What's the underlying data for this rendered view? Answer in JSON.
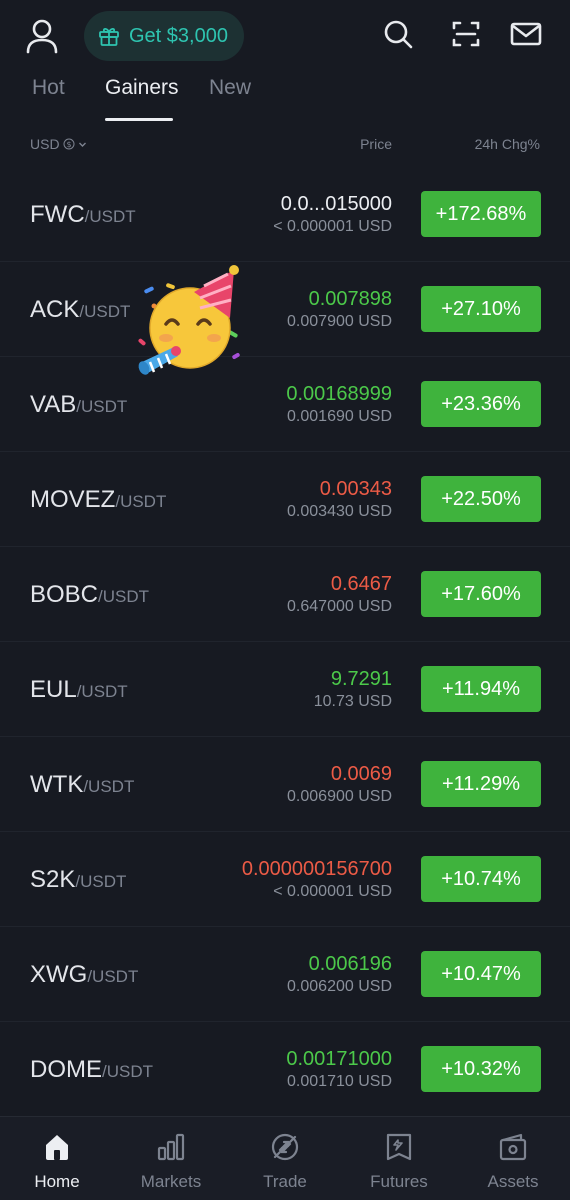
{
  "header": {
    "promo_label": "Get $3,000",
    "icons": [
      "profile-icon",
      "gift-icon",
      "search-icon",
      "scan-icon",
      "mail-icon"
    ]
  },
  "tabs": [
    {
      "label": "Hot",
      "active": false
    },
    {
      "label": "Gainers",
      "active": true
    },
    {
      "label": "New",
      "active": false
    }
  ],
  "columns": {
    "currency": "USD",
    "price": "Price",
    "change": "24h Chg%"
  },
  "colors": {
    "background": "#171a22",
    "accent_teal": "#2ec4b0",
    "up_green": "#4cc94a",
    "down_red": "#ec5b46",
    "change_badge": "#3fb33d"
  },
  "rows": [
    {
      "base": "FWC",
      "quote": "/USDT",
      "price": "0.0...015000",
      "price_color": "white",
      "usd": "< 0.000001 USD",
      "change": "+172.68%"
    },
    {
      "base": "ACK",
      "quote": "/USDT",
      "price": "0.007898",
      "price_color": "green",
      "usd": "0.007900 USD",
      "change": "+27.10%"
    },
    {
      "base": "VAB",
      "quote": "/USDT",
      "price": "0.00168999",
      "price_color": "green",
      "usd": "0.001690 USD",
      "change": "+23.36%"
    },
    {
      "base": "MOVEZ",
      "quote": "/USDT",
      "price": "0.00343",
      "price_color": "red",
      "usd": "0.003430 USD",
      "change": "+22.50%"
    },
    {
      "base": "BOBC",
      "quote": "/USDT",
      "price": "0.6467",
      "price_color": "red",
      "usd": "0.647000 USD",
      "change": "+17.60%"
    },
    {
      "base": "EUL",
      "quote": "/USDT",
      "price": "9.7291",
      "price_color": "green",
      "usd": "10.73 USD",
      "change": "+11.94%"
    },
    {
      "base": "WTK",
      "quote": "/USDT",
      "price": "0.0069",
      "price_color": "red",
      "usd": "0.006900 USD",
      "change": "+11.29%"
    },
    {
      "base": "S2K",
      "quote": "/USDT",
      "price": "0.000000156700",
      "price_color": "red",
      "usd": "< 0.000001 USD",
      "change": "+10.74%"
    },
    {
      "base": "XWG",
      "quote": "/USDT",
      "price": "0.006196",
      "price_color": "green",
      "usd": "0.006200 USD",
      "change": "+10.47%"
    },
    {
      "base": "DOME",
      "quote": "/USDT",
      "price": "0.00171000",
      "price_color": "green",
      "usd": "0.001710 USD",
      "change": "+10.32%"
    }
  ],
  "sticker": "partying-face-emoji",
  "bottom_nav": [
    {
      "label": "Home",
      "icon": "home-icon",
      "active": true
    },
    {
      "label": "Markets",
      "icon": "markets-icon",
      "active": false
    },
    {
      "label": "Trade",
      "icon": "trade-icon",
      "active": false
    },
    {
      "label": "Futures",
      "icon": "futures-icon",
      "active": false
    },
    {
      "label": "Assets",
      "icon": "assets-icon",
      "active": false
    }
  ]
}
